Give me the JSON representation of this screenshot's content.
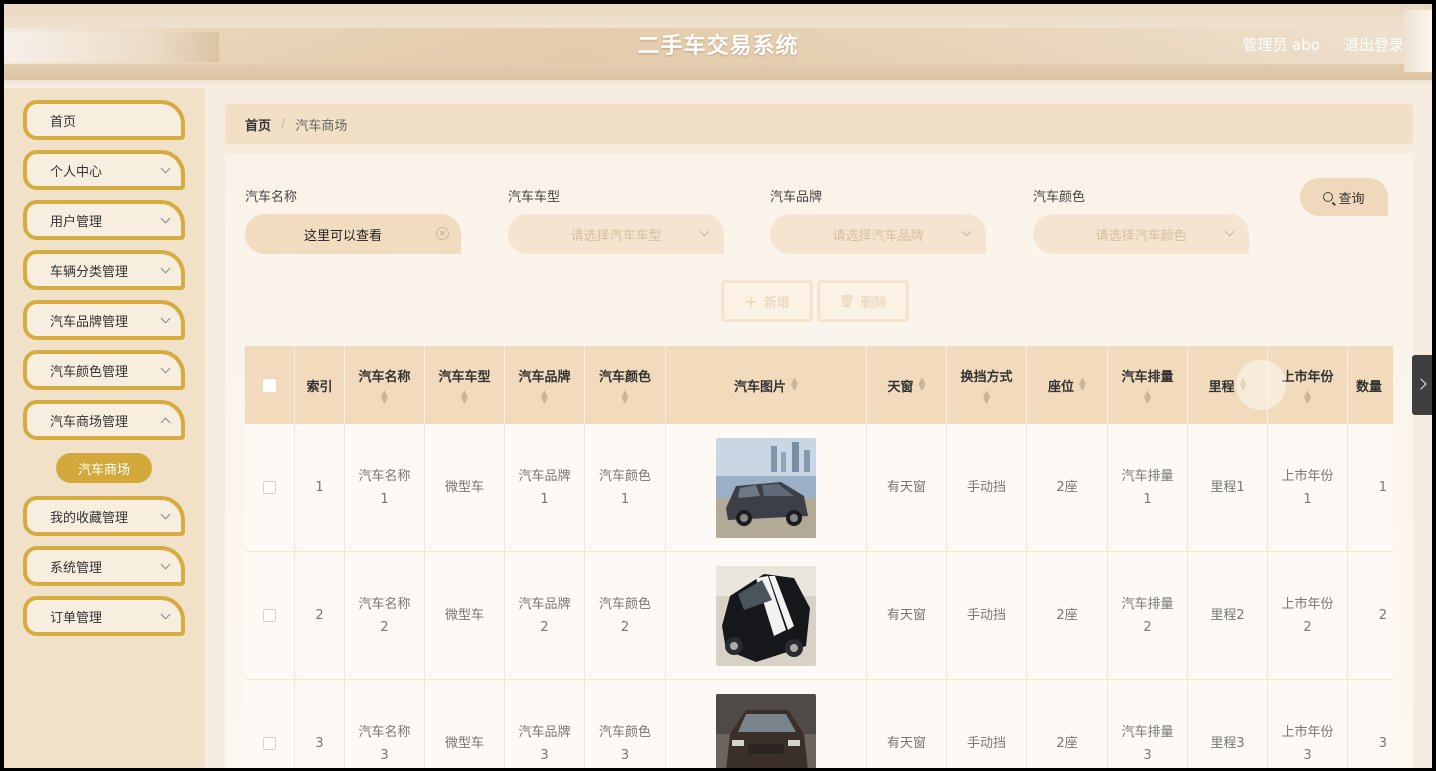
{
  "header": {
    "title": "二手车交易系统",
    "user": "管理员 abo",
    "logout": "退出登录"
  },
  "sidebar": {
    "items": [
      {
        "label": "首页",
        "has_arrow": false
      },
      {
        "label": "个人中心",
        "has_arrow": true
      },
      {
        "label": "用户管理",
        "has_arrow": true
      },
      {
        "label": "车辆分类管理",
        "has_arrow": true
      },
      {
        "label": "汽车品牌管理",
        "has_arrow": true
      },
      {
        "label": "汽车颜色管理",
        "has_arrow": true
      },
      {
        "label": "汽车商场管理",
        "has_arrow": true
      },
      {
        "label": "我的收藏管理",
        "has_arrow": true
      },
      {
        "label": "系统管理",
        "has_arrow": true
      },
      {
        "label": "订单管理",
        "has_arrow": true
      }
    ],
    "active_sub": "汽车商场"
  },
  "breadcrumb": {
    "home": "首页",
    "separator": "/",
    "current": "汽车商场"
  },
  "filters": {
    "name": {
      "label": "汽车名称",
      "value": "这里可以查看"
    },
    "type": {
      "label": "汽车车型",
      "placeholder": "请选择汽车车型"
    },
    "brand": {
      "label": "汽车品牌",
      "placeholder": "请选择汽车品牌"
    },
    "color": {
      "label": "汽车颜色",
      "placeholder": "请选择汽车颜色"
    },
    "query_label": "查询"
  },
  "actions": {
    "add_label": "新增",
    "delete_label": "删除"
  },
  "table": {
    "headers": {
      "index": "索引",
      "name": "汽车名称",
      "type": "汽车车型",
      "brand": "汽车品牌",
      "color": "汽车颜色",
      "image": "汽车图片",
      "sunroof": "天窗",
      "gear": "换挡方式",
      "seats": "座位",
      "displacement": "汽车排量",
      "mileage": "里程",
      "year": "上市年份",
      "quantity": "数量"
    },
    "rows": [
      {
        "index": "1",
        "name_a": "汽车名称",
        "name_b": "1",
        "type": "微型车",
        "brand_a": "汽车品牌",
        "brand_b": "1",
        "color_a": "汽车颜色",
        "color_b": "1",
        "car": "gray-sedan",
        "sunroof": "有天窗",
        "gear": "手动挡",
        "seats": "2座",
        "disp_a": "汽车排量",
        "disp_b": "1",
        "mileage": "里程1",
        "year_a": "上市年份",
        "year_b": "1",
        "quantity": "1"
      },
      {
        "index": "2",
        "name_a": "汽车名称",
        "name_b": "2",
        "type": "微型车",
        "brand_a": "汽车品牌",
        "brand_b": "2",
        "color_a": "汽车颜色",
        "color_b": "2",
        "car": "black-muscle",
        "sunroof": "有天窗",
        "gear": "手动挡",
        "seats": "2座",
        "disp_a": "汽车排量",
        "disp_b": "2",
        "mileage": "里程2",
        "year_a": "上市年份",
        "year_b": "2",
        "quantity": "2"
      },
      {
        "index": "3",
        "name_a": "汽车名称",
        "name_b": "3",
        "type": "微型车",
        "brand_a": "汽车品牌",
        "brand_b": "3",
        "color_a": "汽车颜色",
        "color_b": "3",
        "car": "brown-sedan",
        "sunroof": "有天窗",
        "gear": "手动挡",
        "seats": "2座",
        "disp_a": "汽车排量",
        "disp_b": "3",
        "mileage": "里程3",
        "year_a": "上市年份",
        "year_b": "3",
        "quantity": "3"
      }
    ]
  },
  "colors": {
    "accent": "#d3a93b",
    "header_bg": "#f1dbbc",
    "sidebar_bg": "#f2e1c9"
  }
}
